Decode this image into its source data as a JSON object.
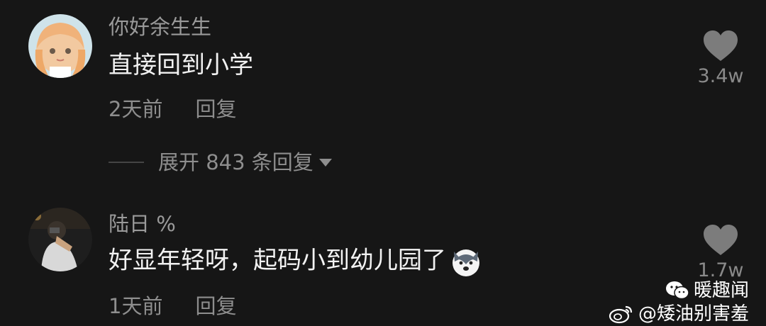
{
  "comments": [
    {
      "username": "你好余生生",
      "text": "直接回到小学",
      "time": "2天前",
      "reply_label": "回复",
      "likes": "3.4w",
      "expand_label": "展开 843 条回复"
    },
    {
      "username": "陆日 %",
      "text": "好显年轻呀，起码小到幼儿园了",
      "time": "1天前",
      "reply_label": "回复",
      "likes": "1.7w"
    }
  ],
  "watermark": {
    "wechat_name": "暖趣闻",
    "weibo_handle": "@矮油别害羞"
  },
  "icons": {
    "like": "heart-icon",
    "emoji": "husky-dog-emoji-icon",
    "expand": "caret-down-icon",
    "wechat": "wechat-icon",
    "weibo": "weibo-icon"
  },
  "colors": {
    "background": "#161616",
    "text_primary": "#f2f2f2",
    "text_secondary": "#8e8e8e",
    "heart": "#7c7c7c"
  }
}
